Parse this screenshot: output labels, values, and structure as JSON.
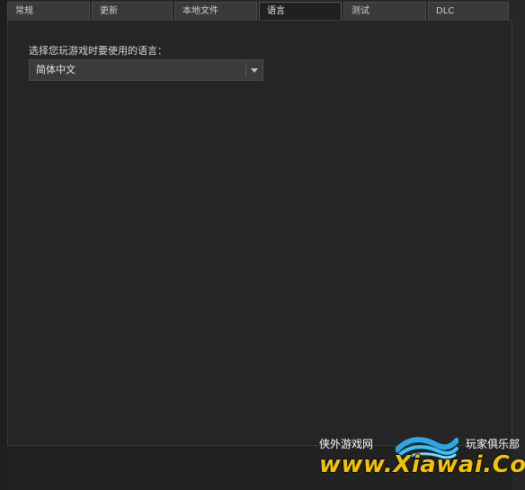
{
  "tabs": [
    {
      "label": "常规"
    },
    {
      "label": "更新"
    },
    {
      "label": "本地文件"
    },
    {
      "label": "语言"
    },
    {
      "label": "测试"
    },
    {
      "label": "DLC"
    }
  ],
  "language": {
    "prompt": "选择您玩游戏时要使用的语言：",
    "selected": "简体中文"
  },
  "watermark": {
    "top_left": "侠外游戏网",
    "top_right": "玩家俱乐部",
    "url": "www.Xiawai.Com"
  },
  "colors": {
    "watermark_yellow": "#f2c300",
    "watermark_blue": "#2aa7e8"
  }
}
